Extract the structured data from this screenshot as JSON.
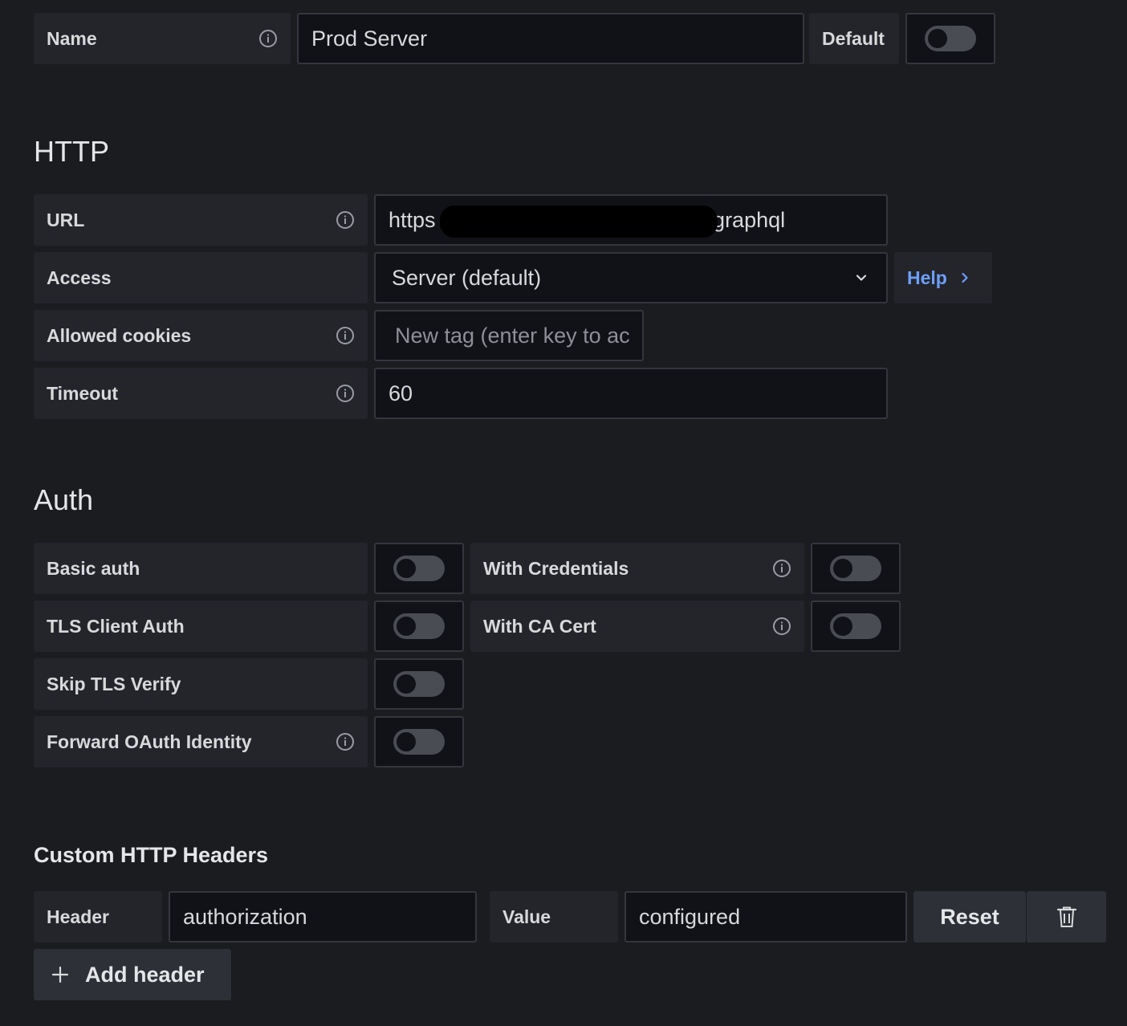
{
  "top": {
    "name_label": "Name",
    "name_value": "Prod Server",
    "default_label": "Default",
    "default_on": false
  },
  "http": {
    "title": "HTTP",
    "url_label": "URL",
    "url_value_prefix": "https",
    "url_value_suffix": "/graphql",
    "access_label": "Access",
    "access_value": "Server (default)",
    "help_label": "Help",
    "cookies_label": "Allowed cookies",
    "cookies_placeholder": "New tag (enter key to ac",
    "timeout_label": "Timeout",
    "timeout_value": "60"
  },
  "auth": {
    "title": "Auth",
    "basic_auth_label": "Basic auth",
    "with_credentials_label": "With Credentials",
    "tls_client_auth_label": "TLS Client Auth",
    "with_ca_cert_label": "With CA Cert",
    "skip_tls_label": "Skip TLS Verify",
    "forward_oauth_label": "Forward OAuth Identity"
  },
  "headers": {
    "title": "Custom HTTP Headers",
    "header_label": "Header",
    "header_value": "authorization",
    "value_label": "Value",
    "value_value": "configured",
    "reset_label": "Reset",
    "add_header_label": "Add header"
  },
  "colors": {
    "background": "#1b1c20",
    "label_bg": "#23252b",
    "input_bg": "#111217",
    "link": "#6e9fff"
  }
}
